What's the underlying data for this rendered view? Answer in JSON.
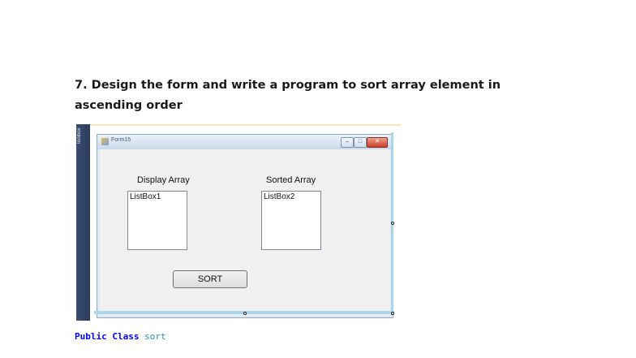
{
  "heading": {
    "number": "7.",
    "text": "Design the form and write a program to sort array element  in ascending order"
  },
  "designer": {
    "toolbox_label": "Toolbox",
    "form_title": "Form15",
    "controls": {
      "minimize": "–",
      "maximize": "□",
      "close": "✕"
    },
    "labels": {
      "display_array": "Display Array",
      "sorted_array": "Sorted Array"
    },
    "listboxes": {
      "listbox1": "ListBox1",
      "listbox2": "ListBox2"
    },
    "sort_button": "SORT"
  },
  "code": {
    "kw_public": "Public",
    "kw_class": "Class",
    "class_name": "sort"
  }
}
